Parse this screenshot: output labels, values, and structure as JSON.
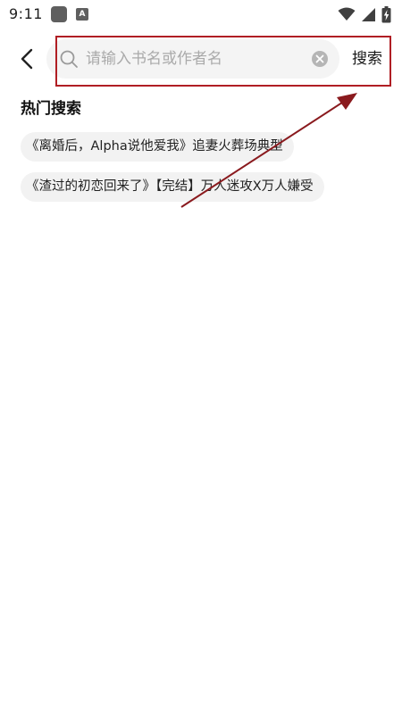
{
  "status_bar": {
    "time": "9:11",
    "app_icon_letter": "A"
  },
  "header": {
    "search_placeholder": "请输入书名或作者名",
    "search_value": "",
    "search_button_label": "搜索"
  },
  "hot_search": {
    "title": "热门搜索",
    "items": [
      "《离婚后，Alpha说他爱我》追妻火葬场典型",
      "《渣过的初恋回来了》【完结】万人迷攻X万人嫌受"
    ]
  },
  "colors": {
    "annotation": "#b01e24",
    "search_box_bg": "#f4f4f4",
    "tag_bg": "#f2f2f2"
  }
}
